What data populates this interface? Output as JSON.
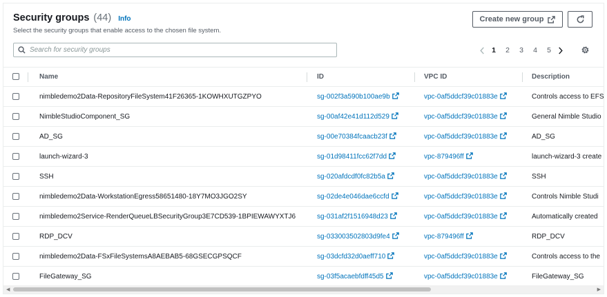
{
  "header": {
    "title": "Security groups",
    "count": "(44)",
    "info_label": "Info",
    "subtitle": "Select the security groups that enable access to the chosen file system.",
    "create_label": "Create new group"
  },
  "search": {
    "placeholder": "Search for security groups",
    "value": ""
  },
  "pagination": {
    "pages": [
      "1",
      "2",
      "3",
      "4",
      "5"
    ],
    "current": "1"
  },
  "table": {
    "columns": {
      "name": "Name",
      "id": "ID",
      "vpc": "VPC ID",
      "description": "Description"
    },
    "rows": [
      {
        "name": "nimbledemo2Data-RepositoryFileSystem41F26365-1KOWHXUTGZPYO",
        "id": "sg-002f3a590b100ae9b",
        "vpc": "vpc-0af5ddcf39c01883e",
        "description": "Controls access to EFS"
      },
      {
        "name": "NimbleStudioComponent_SG",
        "id": "sg-00af42e41d112d529",
        "vpc": "vpc-0af5ddcf39c01883e",
        "description": "General Nimble Studio"
      },
      {
        "name": "AD_SG",
        "id": "sg-00e70384fcaacb23f",
        "vpc": "vpc-0af5ddcf39c01883e",
        "description": "AD_SG"
      },
      {
        "name": "launch-wizard-3",
        "id": "sg-01d98411fcc62f7dd",
        "vpc": "vpc-879496ff",
        "description": "launch-wizard-3 create"
      },
      {
        "name": "SSH",
        "id": "sg-020afdcdf0fc82b5a",
        "vpc": "vpc-0af5ddcf39c01883e",
        "description": "SSH"
      },
      {
        "name": "nimbledemo2Data-WorkstationEgress58651480-18Y7MO3JGO2SY",
        "id": "sg-02de4e046dae6ccfd",
        "vpc": "vpc-0af5ddcf39c01883e",
        "description": "Controls Nimble Studi"
      },
      {
        "name": "nimbledemo2Service-RenderQueueLBSecurityGroup3E7CD539-1BPIEWAWYXTJ6",
        "id": "sg-031af2f1516948d23",
        "vpc": "vpc-0af5ddcf39c01883e",
        "description": "Automatically created"
      },
      {
        "name": "RDP_DCV",
        "id": "sg-033003502803d9fe4",
        "vpc": "vpc-879496ff",
        "description": "RDP_DCV"
      },
      {
        "name": "nimbledemo2Data-FSxFileSystemsA8AEBAB5-68GSECGPSQCF",
        "id": "sg-03dcfd32d0aeff710",
        "vpc": "vpc-0af5ddcf39c01883e",
        "description": "Controls access to the"
      },
      {
        "name": "FileGateway_SG",
        "id": "sg-03f5acaebfdff45d5",
        "vpc": "vpc-0af5ddcf39c01883e",
        "description": "FileGateway_SG"
      }
    ]
  },
  "icons": {
    "external": "external-link-icon",
    "refresh": "refresh-icon",
    "search": "search-icon",
    "settings": "gear-icon",
    "prev": "chevron-left-icon",
    "next": "chevron-right-icon"
  },
  "colors": {
    "link": "#0073bb",
    "text": "#16191f",
    "muted": "#545b64",
    "border": "#eaeded"
  }
}
